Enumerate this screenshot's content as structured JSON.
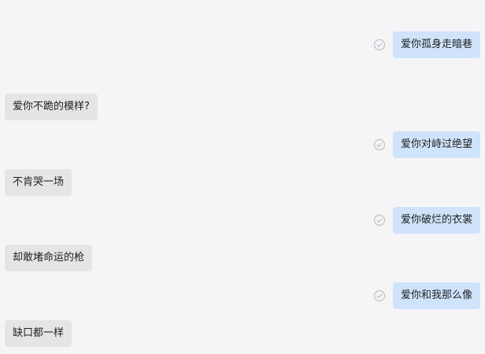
{
  "conversation": {
    "timestamps": [
      "",
      ""
    ],
    "messages": [
      {
        "direction": "outgoing",
        "text": "爱你孤身走暗巷",
        "status_icon": "read-check-icon"
      },
      {
        "direction": "incoming",
        "text": "爱你不跪的模样?"
      },
      {
        "direction": "outgoing",
        "text": "爱你对峙过绝望",
        "status_icon": "read-check-icon"
      },
      {
        "direction": "incoming",
        "text": "不肯哭一场"
      },
      {
        "direction": "outgoing",
        "text": "爱你破烂的衣裳",
        "status_icon": "read-check-icon"
      },
      {
        "direction": "incoming",
        "text": "却敢堵命运的枪"
      },
      {
        "direction": "outgoing",
        "text": "爱你和我那么像",
        "status_icon": "read-check-icon"
      },
      {
        "direction": "incoming",
        "text": "缺口都一样"
      }
    ]
  },
  "colors": {
    "background": "#f5f5f7",
    "outgoing_bubble": "#cfe3fb",
    "incoming_bubble": "#e5e5e7",
    "text": "#1f1f1f",
    "check_icon": "#c2c2c6"
  }
}
